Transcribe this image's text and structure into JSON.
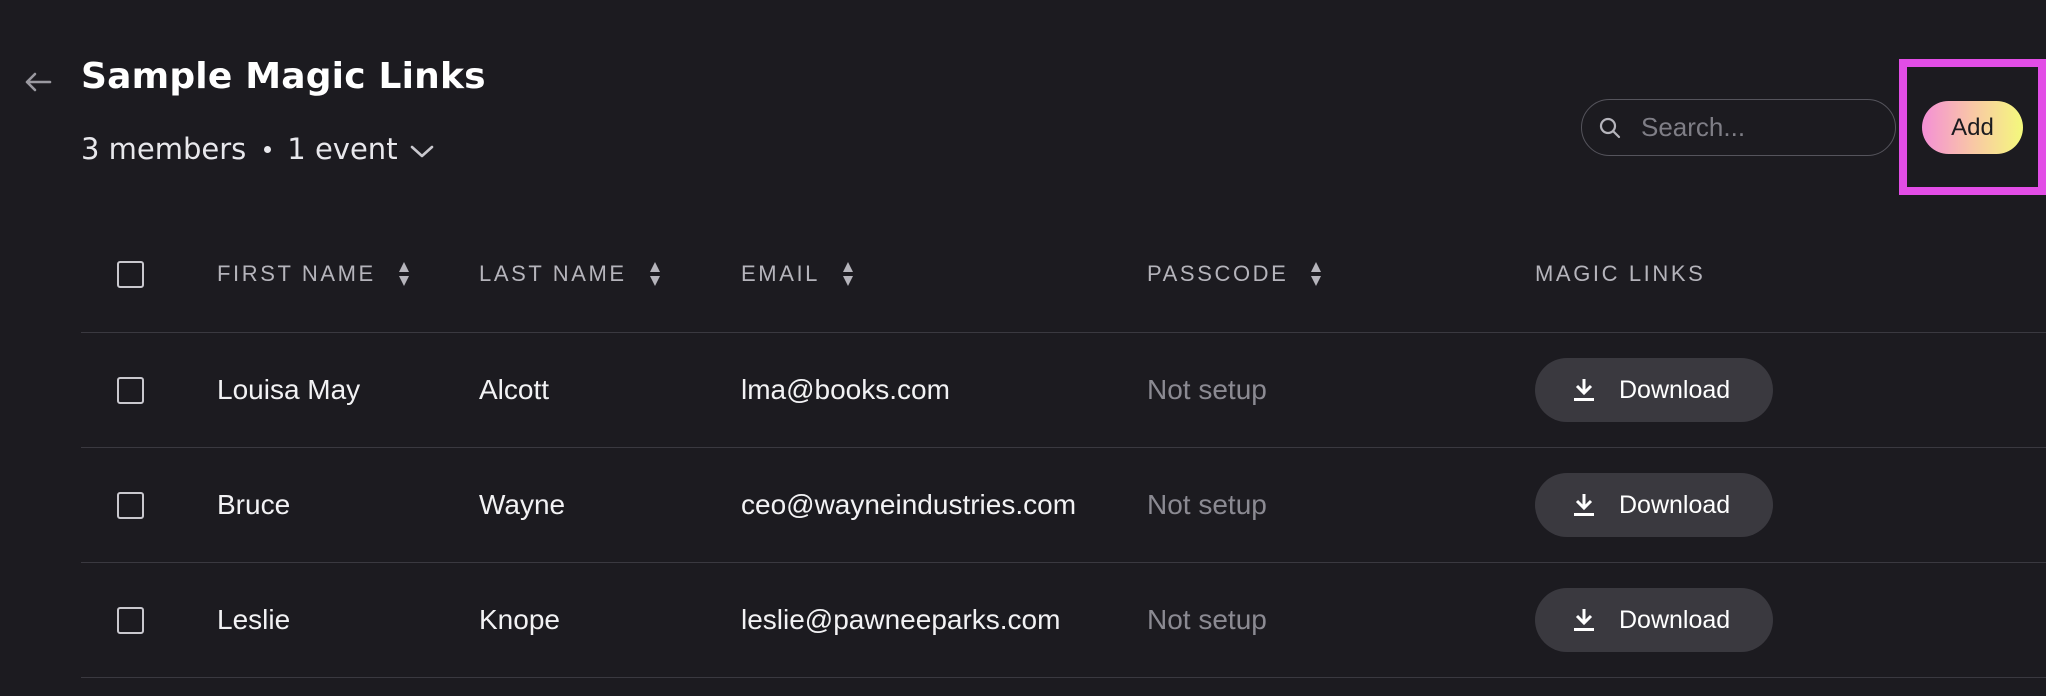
{
  "header": {
    "title": "Sample Magic Links",
    "members": "3 members",
    "events": "1 event"
  },
  "search": {
    "placeholder": "Search...",
    "value": ""
  },
  "toolbar": {
    "add_label": "Add"
  },
  "table": {
    "columns": [
      "FIRST NAME",
      "LAST NAME",
      "EMAIL",
      "PASSCODE",
      "MAGIC LINKS"
    ],
    "rows": [
      {
        "first": "Louisa May",
        "last": "Alcott",
        "email": "lma@books.com",
        "passcode": "Not setup",
        "action": "Download"
      },
      {
        "first": "Bruce",
        "last": "Wayne",
        "email": "ceo@wayneindustries.com",
        "passcode": "Not setup",
        "action": "Download"
      },
      {
        "first": "Leslie",
        "last": "Knope",
        "email": "leslie@pawneeparks.com",
        "passcode": "Not setup",
        "action": "Download"
      }
    ]
  },
  "icons": {
    "back": "arrow-left-icon",
    "events_toggle": "chevron-down-icon",
    "search": "search-icon",
    "sort": "sort-icon",
    "download": "download-icon"
  },
  "colors": {
    "background": "#1c1b20",
    "highlight": "#e24de6",
    "add_gradient_start": "#f48fd6",
    "add_gradient_end": "#f4f97c",
    "download_button": "#3a393f",
    "muted_text": "#8b8a92"
  }
}
